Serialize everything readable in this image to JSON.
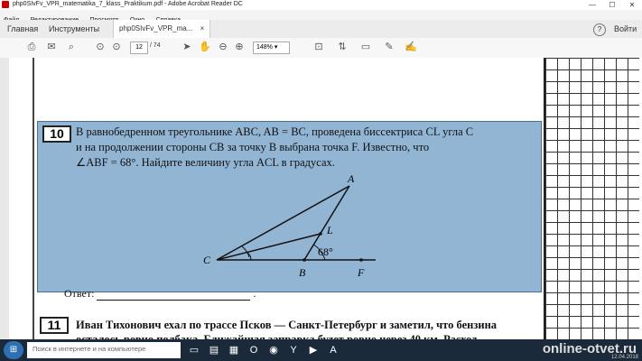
{
  "window": {
    "title": "php0SIvFv_VPR_matematika_7_klass_Praktikum.pdf - Adobe Acrobat Reader DC",
    "minimize": "—",
    "maximize": "☐",
    "close": "✕"
  },
  "menu": [
    "Файл",
    "Редактирование",
    "Просмотр",
    "Окно",
    "Справка"
  ],
  "tabs": {
    "home": "Главная",
    "tools": "Инструменты",
    "doc": "php0SIvFv_VPR_ma...",
    "doc_close": "×",
    "help": "?",
    "login": "Войти"
  },
  "toolbar": {
    "page_current": "12",
    "page_total": "/ 74",
    "zoom": "148%"
  },
  "task10": {
    "number": "10",
    "line1": "В равнобедренном треугольнике ABC, AB = BC, проведена биссектриса CL угла C",
    "line2": "и на продолжении стороны CB за точку B выбрана точка F. Известно, что",
    "line3": "∠ABF = 68°. Найдите величину угла ACL в градусах.",
    "labels": {
      "A": "A",
      "L": "L",
      "C": "C",
      "B": "B",
      "F": "F",
      "angle": "68°"
    }
  },
  "answer_label": "Ответ:",
  "task11": {
    "number": "11",
    "line1": "Иван Тихонович ехал по трассе Псков — Санкт-Петербург и заметил, что бензина",
    "line2": "осталось ровно полбака. Ближайшая заправка будет ровно через 40 км. Расход"
  },
  "taskbar": {
    "search_placeholder": "Поиск в интернете и на компьютере",
    "watermark": "online-otvet.ru",
    "clock": "12.04.2018"
  },
  "colors": {
    "task_highlight": "#93b5d4",
    "taskbar": "#1b2a3a"
  }
}
